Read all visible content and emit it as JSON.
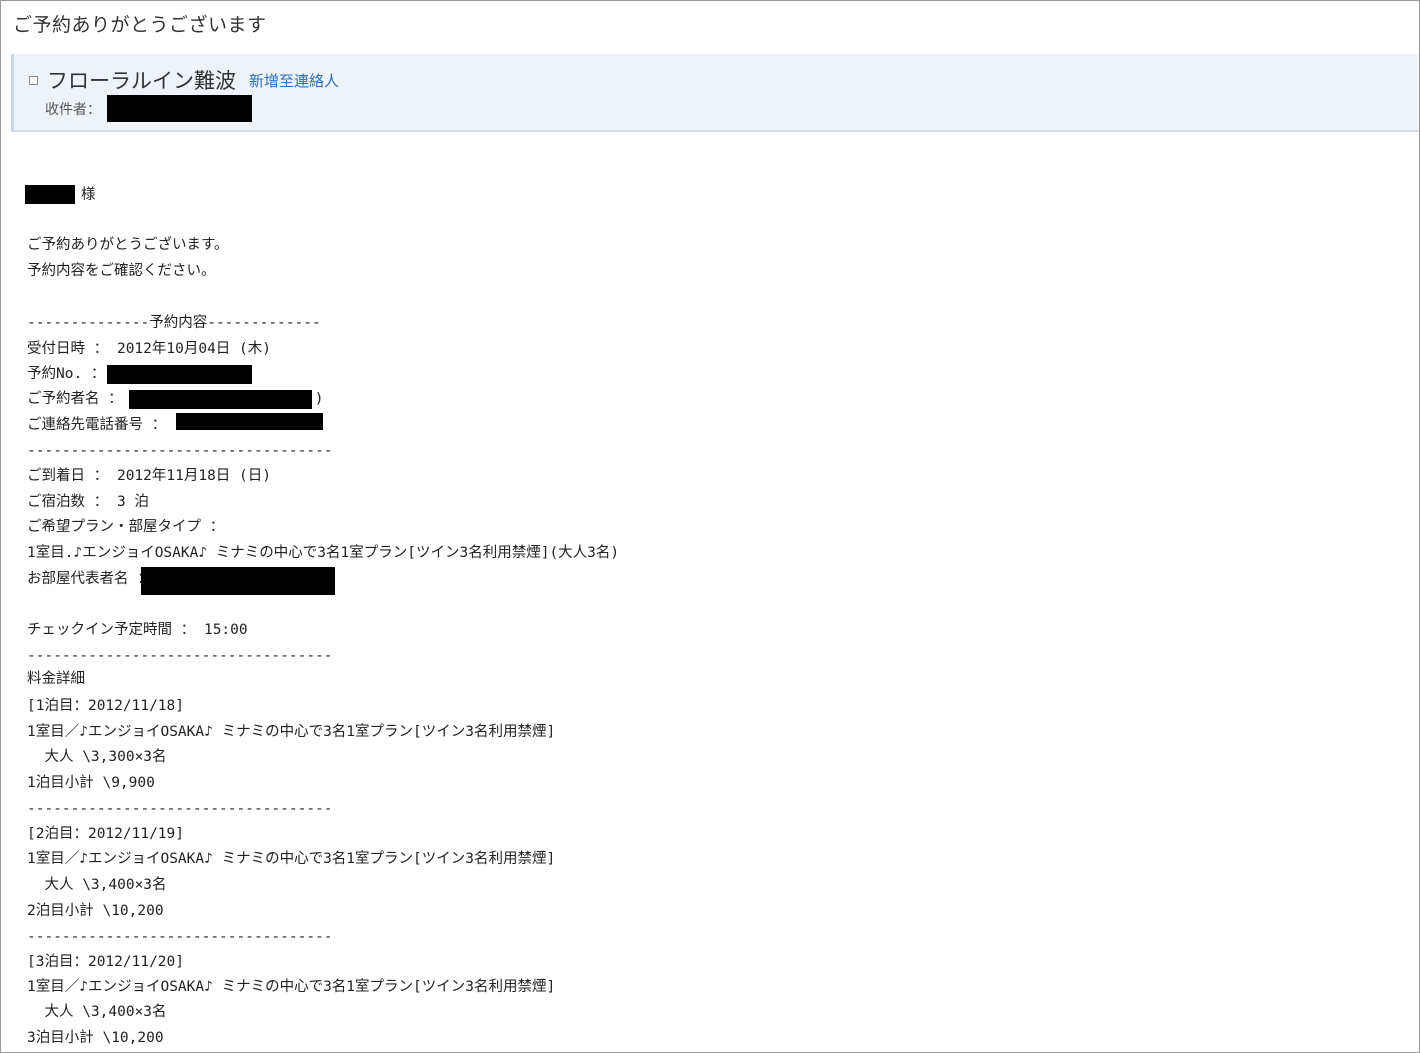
{
  "email": {
    "subject": "ご予約ありがとうございます",
    "sender_name": "フローラルイン難波",
    "add_contact": "新增至連絡人",
    "recipient_label": "收件者："
  },
  "greeting": {
    "honorific": "様"
  },
  "body": {
    "lines": [
      "ご予約ありがとうございます。",
      "予約内容をご確認ください。",
      "--------------予約内容-------------",
      "受付日時 ： 2012年10月04日 (木)",
      "予約No. ：",
      "ご予約者名 ：                      )",
      "ご連絡先電話番号 ：",
      "-----------------------------------",
      "ご到着日 ： 2012年11月18日 (日)",
      "ご宿泊数 ： 3 泊",
      "ご希望プラン・部屋タイプ ：",
      "1室目.♪エンジョイOSAKA♪ ミナミの中心で3名1室プラン[ツイン3名利用禁煙](大人3名)",
      "お部屋代表者名 ：",
      "チェックイン予定時間 ： 15:00",
      "-----------------------------------",
      "料金詳細",
      "[1泊目：2012/11/18]",
      "1室目／♪エンジョイOSAKA♪ ミナミの中心で3名1室プラン[ツイン3名利用禁煙]",
      "  大人 \\3,300×3名",
      "1泊目小計 \\9,900",
      "-----------------------------------",
      "[2泊目：2012/11/19]",
      "1室目／♪エンジョイOSAKA♪ ミナミの中心で3名1室プラン[ツイン3名利用禁煙]",
      "  大人 \\3,400×3名",
      "2泊目小計 \\10,200",
      "-----------------------------------",
      "[3泊目：2012/11/20]",
      "1室目／♪エンジョイOSAKA♪ ミナミの中心で3名1室プラン[ツイン3名利用禁煙]",
      "  大人 \\3,400×3名",
      "3泊目小計 \\10,200"
    ]
  }
}
